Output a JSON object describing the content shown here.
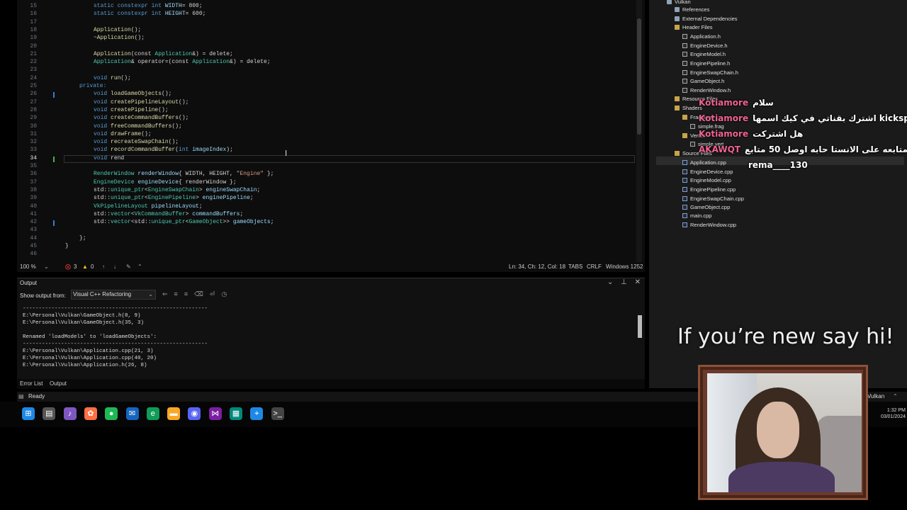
{
  "editor": {
    "lines": [
      {
        "n": "15",
        "segments": [
          [
            "kw",
            "static constexpr int "
          ],
          [
            "pr",
            "WIDTH"
          ],
          [
            "",
            "= 800;"
          ]
        ]
      },
      {
        "n": "16",
        "segments": [
          [
            "kw",
            "static constexpr int "
          ],
          [
            "pr",
            "HEIGHT"
          ],
          [
            "",
            "= 600;"
          ]
        ]
      },
      {
        "n": "17",
        "segments": []
      },
      {
        "n": "18",
        "segments": [
          [
            "fn",
            "Application"
          ],
          [
            "",
            "();"
          ]
        ]
      },
      {
        "n": "19",
        "segments": [
          [
            "fn",
            "~Application"
          ],
          [
            "",
            "();"
          ]
        ]
      },
      {
        "n": "20",
        "segments": []
      },
      {
        "n": "21",
        "segments": [
          [
            "fn",
            "Application"
          ],
          [
            "",
            "(const "
          ],
          [
            "ty",
            "Application"
          ],
          [
            "",
            "&) = delete;"
          ]
        ]
      },
      {
        "n": "22",
        "segments": [
          [
            "ty",
            "Application"
          ],
          [
            "",
            "& operator=(const "
          ],
          [
            "ty",
            "Application"
          ],
          [
            "",
            "&) = delete;"
          ]
        ]
      },
      {
        "n": "23",
        "segments": []
      },
      {
        "n": "24",
        "segments": [
          [
            "kw",
            "void "
          ],
          [
            "fn",
            "run"
          ],
          [
            "",
            "();"
          ]
        ]
      },
      {
        "n": "25",
        "segments": [
          [
            "kw",
            "private:"
          ]
        ],
        "indent": 1
      },
      {
        "n": "26",
        "segments": [
          [
            "kw",
            "void "
          ],
          [
            "fn",
            "loadGameObjects"
          ],
          [
            "",
            "();"
          ]
        ]
      },
      {
        "n": "27",
        "segments": [
          [
            "kw",
            "void "
          ],
          [
            "fn",
            "createPipelineLayout"
          ],
          [
            "",
            "();"
          ]
        ]
      },
      {
        "n": "28",
        "segments": [
          [
            "kw",
            "void "
          ],
          [
            "fn",
            "createPipeline"
          ],
          [
            "",
            "();"
          ]
        ]
      },
      {
        "n": "29",
        "segments": [
          [
            "kw",
            "void "
          ],
          [
            "fn",
            "createCommandBuffers"
          ],
          [
            "",
            "();"
          ]
        ]
      },
      {
        "n": "30",
        "segments": [
          [
            "kw",
            "void "
          ],
          [
            "fn",
            "freeCommandBuffers"
          ],
          [
            "",
            "();"
          ]
        ]
      },
      {
        "n": "31",
        "segments": [
          [
            "kw",
            "void "
          ],
          [
            "fn",
            "drawFrame"
          ],
          [
            "",
            "();"
          ]
        ]
      },
      {
        "n": "32",
        "segments": [
          [
            "kw",
            "void "
          ],
          [
            "fn",
            "recreateSwapChain"
          ],
          [
            "",
            "();"
          ]
        ]
      },
      {
        "n": "33",
        "segments": [
          [
            "kw",
            "void "
          ],
          [
            "fn",
            "recordCommandBuffer"
          ],
          [
            "",
            "("
          ],
          [
            "kw",
            "int "
          ],
          [
            "pr",
            "imageIndex"
          ],
          [
            "",
            ");"
          ]
        ]
      },
      {
        "n": "34",
        "segments": [
          [
            "kw",
            "void "
          ],
          [
            "",
            "rend"
          ]
        ],
        "current": true
      },
      {
        "n": "35",
        "segments": []
      },
      {
        "n": "36",
        "segments": [
          [
            "ty",
            "RenderWindow "
          ],
          [
            "pr",
            "renderWindow"
          ],
          [
            "",
            "{ WIDTH, HEIGHT, "
          ],
          [
            "str",
            "\"Engine\""
          ],
          [
            "",
            " };"
          ]
        ]
      },
      {
        "n": "37",
        "segments": [
          [
            "ty",
            "EngineDevice "
          ],
          [
            "pr",
            "engineDevice"
          ],
          [
            "",
            "{ renderWindow };"
          ]
        ]
      },
      {
        "n": "38",
        "segments": [
          [
            "",
            "std::"
          ],
          [
            "ty",
            "unique_ptr"
          ],
          [
            "",
            "<"
          ],
          [
            "ty",
            "EngineSwapChain"
          ],
          [
            "",
            "> "
          ],
          [
            "pr",
            "engineSwapChain"
          ],
          [
            "",
            ";"
          ]
        ]
      },
      {
        "n": "39",
        "segments": [
          [
            "",
            "std::"
          ],
          [
            "ty",
            "unique_ptr"
          ],
          [
            "",
            "<"
          ],
          [
            "ty",
            "EnginePipeline"
          ],
          [
            "",
            "> "
          ],
          [
            "pr",
            "enginePipeline"
          ],
          [
            "",
            ";"
          ]
        ]
      },
      {
        "n": "40",
        "segments": [
          [
            "ty",
            "VkPipelineLayout "
          ],
          [
            "pr",
            "pipelineLayout"
          ],
          [
            "",
            ";"
          ]
        ]
      },
      {
        "n": "41",
        "segments": [
          [
            "",
            "std::"
          ],
          [
            "ty",
            "vector"
          ],
          [
            "",
            "<"
          ],
          [
            "ty",
            "VkCommandBuffer"
          ],
          [
            "",
            "> "
          ],
          [
            "pr",
            "commandBuffers"
          ],
          [
            "",
            ";"
          ]
        ]
      },
      {
        "n": "42",
        "segments": [
          [
            "",
            "std::"
          ],
          [
            "ty",
            "vector"
          ],
          [
            "",
            "<std::"
          ],
          [
            "ty",
            "unique_ptr"
          ],
          [
            "",
            "<"
          ],
          [
            "ty",
            "GameObject"
          ],
          [
            "",
            ">> "
          ],
          [
            "pr",
            "gameObjects"
          ],
          [
            "",
            ";"
          ]
        ]
      },
      {
        "n": "43",
        "segments": []
      },
      {
        "n": "44",
        "segments": [
          [
            "",
            "};"
          ]
        ],
        "indent": 1
      },
      {
        "n": "45",
        "segments": [
          [
            "",
            "}"
          ]
        ],
        "indent": 0
      },
      {
        "n": "46",
        "segments": []
      }
    ]
  },
  "editor_status": {
    "zoom": "100 %",
    "errors": "3",
    "warnings": "0",
    "position": "Ln: 34, Ch: 12, Col: 18",
    "tabs": "TABS",
    "eol": "CRLF",
    "encoding": "Windows 1252"
  },
  "output": {
    "title": "Output",
    "show_from_label": "Show output from:",
    "source": "Visual C++ Refactoring",
    "text": "----------------------------------------------------------\nE:\\Personal\\Vulkan\\GameObject.h(8, 9)\nE:\\Personal\\Vulkan\\GameObject.h(35, 3)\n\nRenamed 'loadModels' to 'loadGameObjects':\n----------------------------------------------------------\nE:\\Personal\\Vulkan\\Application.cpp(21, 3)\nE:\\Personal\\Vulkan\\Application.cpp(40, 20)\nE:\\Personal\\Vulkan\\Application.h(26, 8)"
  },
  "bottom_tabs": {
    "error_list": "Error List",
    "output": "Output"
  },
  "solution": {
    "items": [
      {
        "label": "Vulkan",
        "icon": "ref",
        "depth": 1
      },
      {
        "label": "References",
        "icon": "ref",
        "depth": 2
      },
      {
        "label": "External Dependencies",
        "icon": "ref",
        "depth": 2
      },
      {
        "label": "Header Files",
        "icon": "folder",
        "depth": 2
      },
      {
        "label": "Application.h",
        "icon": "h",
        "depth": 3
      },
      {
        "label": "EngineDevice.h",
        "icon": "h",
        "depth": 3
      },
      {
        "label": "EngineModel.h",
        "icon": "h",
        "depth": 3
      },
      {
        "label": "EnginePipeline.h",
        "icon": "h",
        "depth": 3
      },
      {
        "label": "EngineSwapChain.h",
        "icon": "h",
        "depth": 3
      },
      {
        "label": "GameObject.h",
        "icon": "h",
        "depth": 3
      },
      {
        "label": "RenderWindow.h",
        "icon": "h",
        "depth": 3
      },
      {
        "label": "Resource Files",
        "icon": "folder",
        "depth": 2
      },
      {
        "label": "Shaders",
        "icon": "folder",
        "depth": 2
      },
      {
        "label": "Fragment",
        "icon": "folder",
        "depth": 3
      },
      {
        "label": "simple.frag",
        "icon": "h",
        "depth": 4
      },
      {
        "label": "Vertex",
        "icon": "folder",
        "depth": 3
      },
      {
        "label": "simple.vert",
        "icon": "h",
        "depth": 4
      },
      {
        "label": "Source Files",
        "icon": "folder",
        "depth": 2
      },
      {
        "label": "Application.cpp",
        "icon": "cpp",
        "depth": 3
      },
      {
        "label": "EngineDevice.cpp",
        "icon": "cpp",
        "depth": 3
      },
      {
        "label": "EngineModel.cpp",
        "icon": "cpp",
        "depth": 3
      },
      {
        "label": "EnginePipeline.cpp",
        "icon": "cpp",
        "depth": 3
      },
      {
        "label": "EngineSwapChain.cpp",
        "icon": "cpp",
        "depth": 3
      },
      {
        "label": "GameObject.cpp",
        "icon": "cpp",
        "depth": 3
      },
      {
        "label": "main.cpp",
        "icon": "cpp",
        "depth": 3
      },
      {
        "label": "RenderWindow.cpp",
        "icon": "cpp",
        "depth": 3
      }
    ]
  },
  "chat": [
    {
      "user": "Kotiamore",
      "message": "سلام"
    },
    {
      "user": "Kotiamore",
      "message": "اشترك بقناتي في كيك اسمها kicksportlive"
    },
    {
      "user": "Kotiamore",
      "message": "هل اشتركت"
    },
    {
      "user": "AKAWQT",
      "message": "ممكن متابعه على الانستا حابه اوصل 50 متابع"
    },
    {
      "user": "",
      "message": "rema____130"
    }
  ],
  "overlay": {
    "hi_text": "If you’re new say hi!"
  },
  "vs_status": {
    "ready": "Ready",
    "project": "Vulkan"
  },
  "clock": {
    "time": "1:32 PM",
    "date": "03/01/2024"
  },
  "taskbar": {
    "icons": [
      "windows-icon",
      "file-explorer-icon",
      "audio-icon",
      "copilot-icon",
      "spotify-icon",
      "outlook-icon",
      "edge-icon",
      "folder-icon",
      "discord-icon",
      "visual-studio-icon",
      "terminal-icon",
      "maps-icon",
      "console-icon"
    ]
  },
  "colors": {
    "accent_name": "#f06292",
    "keyword": "#569cd6",
    "type": "#4ec9b0"
  }
}
